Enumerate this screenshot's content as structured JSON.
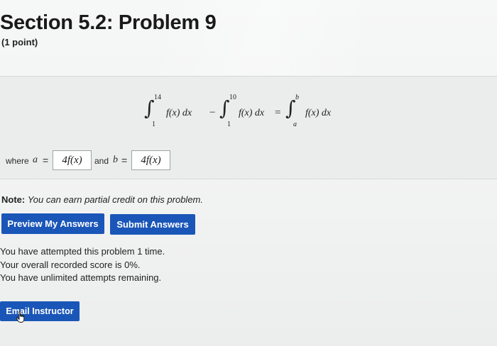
{
  "header": {
    "title": "Section 5.2: Problem 9",
    "points": "(1 point)"
  },
  "problem": {
    "integral1": {
      "upper": "14",
      "lower": "1",
      "integrand": "f(x) dx"
    },
    "minus": "−",
    "integral2": {
      "upper": "10",
      "lower": "1",
      "integrand": "f(x) dx"
    },
    "equals": "=",
    "integral3": {
      "upper": "b",
      "lower": "a",
      "integrand": "f(x) dx"
    },
    "answer_prefix": "where",
    "var_a": "a",
    "var_b": "b",
    "eq_sign": "=",
    "and_text": "and",
    "answer_a_value": "4f(x)",
    "answer_b_value": "4f(x)"
  },
  "note": {
    "label": "Note:",
    "text": "You can earn partial credit on this problem."
  },
  "buttons": {
    "preview": "Preview My Answers",
    "submit": "Submit Answers",
    "email": "Email Instructor"
  },
  "status": {
    "attempted": "You have attempted this problem 1 time.",
    "score": "Your overall recorded score is 0%.",
    "remaining": "You have unlimited attempts remaining."
  },
  "colors": {
    "button_blue": "#1a56b8",
    "problem_bg": "#ebecec"
  }
}
